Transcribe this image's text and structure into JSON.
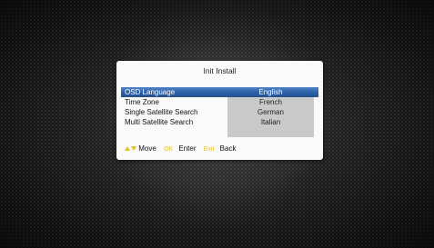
{
  "dialog": {
    "title": "Init Install"
  },
  "menu": {
    "items": [
      {
        "label": "OSD Language",
        "selected": true
      },
      {
        "label": "Time Zone",
        "selected": false
      },
      {
        "label": "Single Satellite Search",
        "selected": false
      },
      {
        "label": "Multi Satellite Search",
        "selected": false
      }
    ]
  },
  "language_options": {
    "items": [
      "English",
      "French",
      "German",
      "Italian"
    ],
    "selected": "English"
  },
  "help": {
    "move_icon": "up-down-arrow-icon",
    "move_label": "Move",
    "ok_key": "OK",
    "enter_label": "Enter",
    "exit_key": "Exit",
    "back_label": "Back"
  },
  "colors": {
    "selection_blue": "#2c5fa6",
    "key_yellow": "#e6c21f",
    "option_gray": "#c9c9c9"
  }
}
